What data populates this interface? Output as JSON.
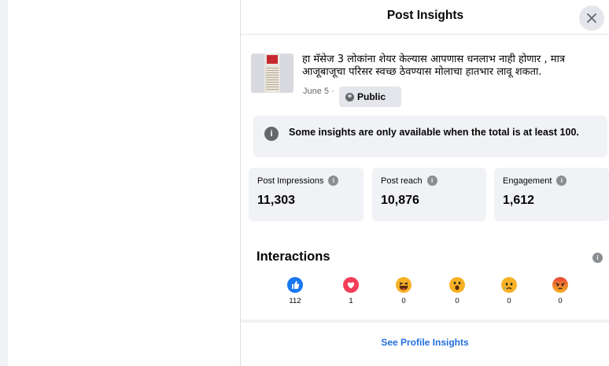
{
  "header": {
    "title": "Post Insights"
  },
  "post": {
    "text": "हा मॅसेज 3 लोकांना शेयर केल्यास आपणास धनलाभ नाही होणार , मात्र आजूबाजूचा परिसर स्वच्छ ठेवण्यास मोलाचा हातभार लावू शकता.",
    "date": "June 5",
    "separator": "·",
    "audience": "Public"
  },
  "notice": {
    "text": "Some insights are only available when the total is at least 100."
  },
  "metrics": [
    {
      "label": "Post Impressions",
      "value": "11,303"
    },
    {
      "label": "Post reach",
      "value": "10,876"
    },
    {
      "label": "Engagement",
      "value": "1,612"
    }
  ],
  "interactions": {
    "title": "Interactions",
    "reactions": [
      {
        "icon": "like-icon",
        "count": "112",
        "color": "#1877f2"
      },
      {
        "icon": "love-icon",
        "count": "1",
        "color": "#f33e58"
      },
      {
        "icon": "haha-icon",
        "count": "0",
        "color": "#f7b125"
      },
      {
        "icon": "wow-icon",
        "count": "0",
        "color": "#f7b125"
      },
      {
        "icon": "sad-icon",
        "count": "0",
        "color": "#f7b125"
      },
      {
        "icon": "angry-icon",
        "count": "0",
        "color": "#e9710f"
      }
    ]
  },
  "footer": {
    "link": "See Profile Insights",
    "link_color": "#216fdb"
  }
}
